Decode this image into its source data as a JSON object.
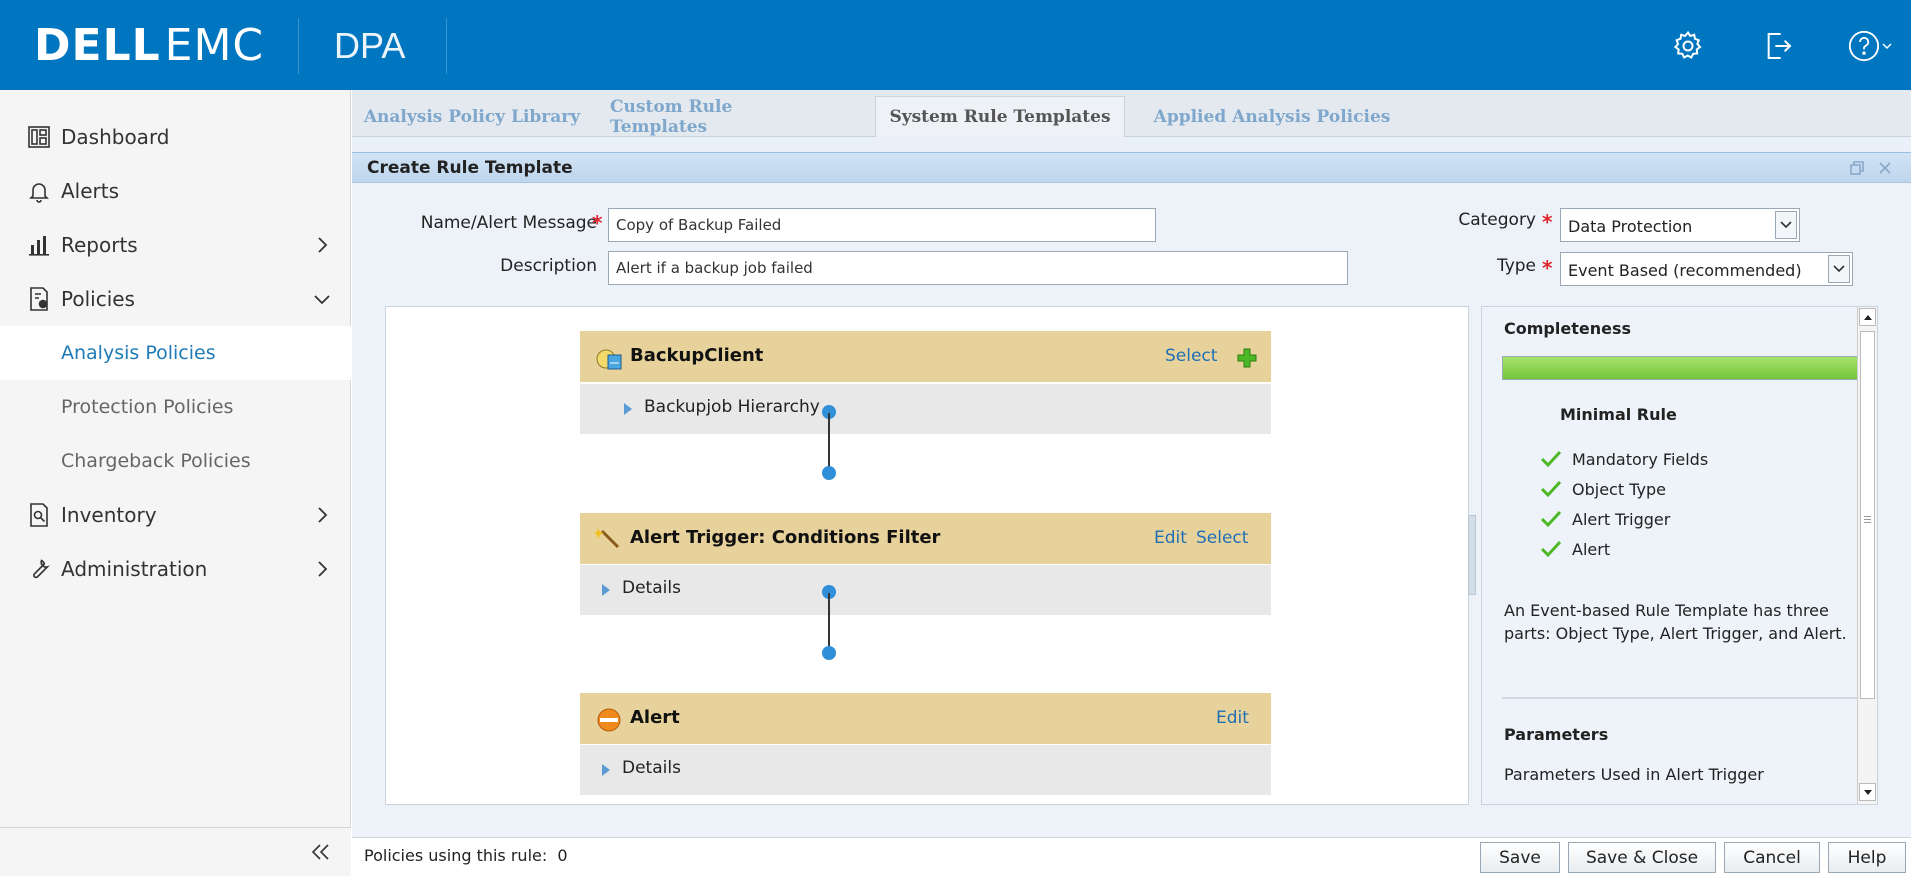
{
  "header": {
    "brand_dell": "DELL",
    "brand_emc": "EMC",
    "product": "DPA",
    "icons": [
      "gear-icon",
      "logout-icon",
      "help-icon"
    ]
  },
  "sidebar": {
    "items": [
      {
        "label": "Dashboard",
        "icon": "dashboard-icon"
      },
      {
        "label": "Alerts",
        "icon": "bell-icon"
      },
      {
        "label": "Reports",
        "icon": "bar-chart-icon"
      },
      {
        "label": "Policies",
        "icon": "policy-icon"
      },
      {
        "label": "Inventory",
        "icon": "inventory-icon"
      },
      {
        "label": "Administration",
        "icon": "wrench-icon"
      }
    ],
    "policies_sub": [
      {
        "label": "Analysis Policies",
        "active": true
      },
      {
        "label": "Protection Policies",
        "active": false
      },
      {
        "label": "Chargeback Policies",
        "active": false
      }
    ]
  },
  "tabs": [
    {
      "label": "Analysis Policy Library"
    },
    {
      "label": "Custom Rule Templates"
    },
    {
      "label": "System Rule Templates"
    },
    {
      "label": "Applied Analysis Policies"
    }
  ],
  "panel": {
    "title": "Create Rule Template"
  },
  "form": {
    "name_label": "Name/Alert Message",
    "name_value": "Copy of Backup Failed",
    "description_label": "Description",
    "description_value": "Alert if a backup job  failed",
    "category_label": "Category",
    "category_value": "Data Protection",
    "type_label": "Type",
    "type_value": "Event Based (recommended)",
    "required_mark": "*"
  },
  "nodes": [
    {
      "title": "BackupClient",
      "links": [
        "Select"
      ],
      "detail": "Backupjob Hierarchy"
    },
    {
      "title": "Alert Trigger: Conditions Filter",
      "links": [
        "Edit",
        "Select"
      ],
      "detail": "Details"
    },
    {
      "title": "Alert",
      "links": [
        "Edit"
      ],
      "detail": "Details"
    }
  ],
  "completeness": {
    "title": "Completeness",
    "progress_percent": 100,
    "level": "Minimal Rule",
    "checks": [
      "Mandatory Fields",
      "Object Type",
      "Alert Trigger",
      "Alert"
    ],
    "description": "An Event-based Rule Template has three parts: Object Type, Alert Trigger, and Alert.",
    "params_title": "Parameters",
    "params_text": "Parameters Used in Alert Trigger"
  },
  "footer": {
    "usage_label": "Policies using this rule:",
    "usage_count": "0",
    "buttons": [
      "Save",
      "Save & Close",
      "Cancel",
      "Help"
    ]
  },
  "colors": {
    "topbar": "#0076c0",
    "node_header": "#e8d29b",
    "link": "#1f6fb5",
    "required": "#e0262e",
    "progress": "#74c63a"
  }
}
